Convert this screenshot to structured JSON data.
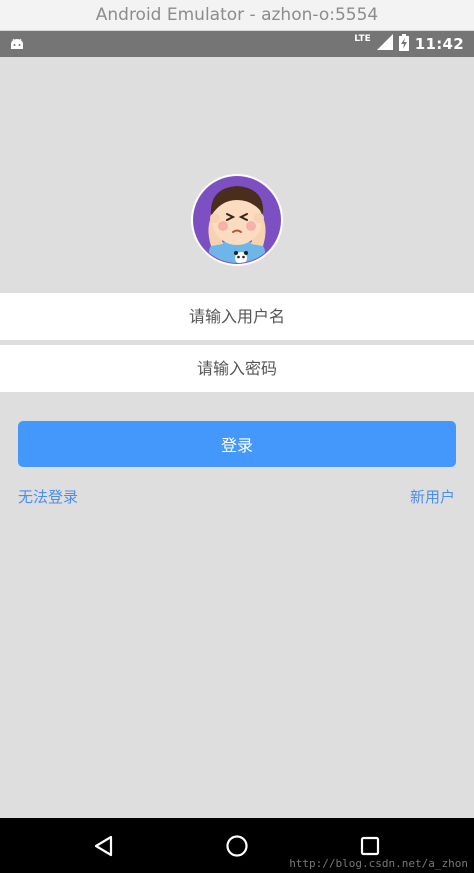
{
  "window": {
    "title": "Android Emulator - azhon-o:5554"
  },
  "status_bar": {
    "network": "LTE",
    "time": "11:42",
    "notification_icon": "android-icon",
    "signal_icon": "signal-icon",
    "battery_icon": "battery-charging-icon"
  },
  "login": {
    "avatar_icon": "cartoon-boy-avatar",
    "username_placeholder": "请输入用户名",
    "password_placeholder": "请输入密码",
    "login_label": "登录",
    "forgot_label": "无法登录",
    "new_user_label": "新用户"
  },
  "nav_bar": {
    "back_icon": "back-triangle-icon",
    "home_icon": "home-circle-icon",
    "recent_icon": "recent-square-icon"
  },
  "watermark": "http://blog.csdn.net/a_zhon",
  "colors": {
    "accent": "#4598fb",
    "link": "#4a8ef0",
    "background": "#dedede",
    "status_bar": "#757575"
  }
}
